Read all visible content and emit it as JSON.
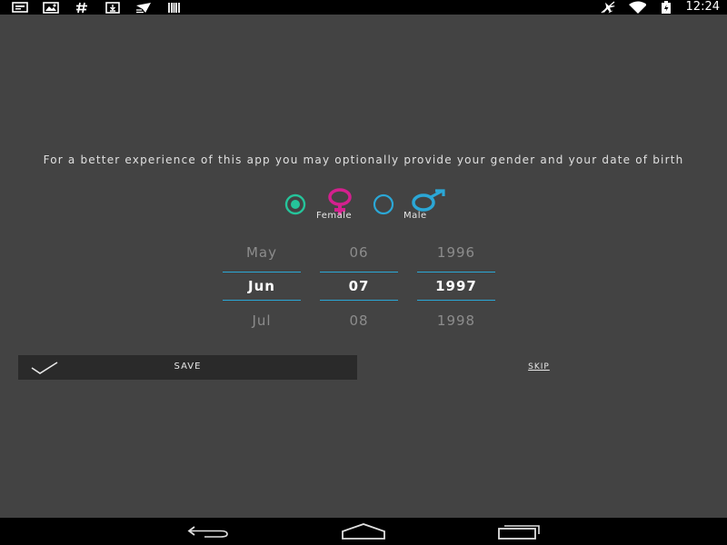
{
  "status_bar": {
    "left_icons": [
      "notification-card-icon",
      "gallery-icon",
      "hash-icon",
      "download-icon",
      "airplane-notification-icon",
      "barcode-icon"
    ],
    "right_icons": [
      "airplane-mode-icon",
      "wifi-icon",
      "battery-icon"
    ],
    "time": "12:24"
  },
  "intro_text": "For a better experience of this app you may optionally provide your gender and your date of birth",
  "gender": {
    "options": [
      {
        "label": "Female",
        "icon": "female-symbol-icon",
        "color": "#d4208e",
        "selected": true
      },
      {
        "label": "Male",
        "icon": "male-symbol-icon",
        "color": "#2ba7d6",
        "selected": false
      }
    ],
    "selected_radio_color": "#25c49a"
  },
  "date_picker": {
    "month": {
      "prev": "May",
      "current": "Jun",
      "next": "Jul"
    },
    "day": {
      "prev": "06",
      "current": "07",
      "next": "08"
    },
    "year": {
      "prev": "1996",
      "current": "1997",
      "next": "1998"
    },
    "accent": "#2ba7d6"
  },
  "actions": {
    "save_label": "SAVE",
    "skip_label": "SKIP"
  },
  "nav_bar": {
    "buttons": [
      "back-icon",
      "home-icon",
      "recent-apps-icon"
    ]
  }
}
